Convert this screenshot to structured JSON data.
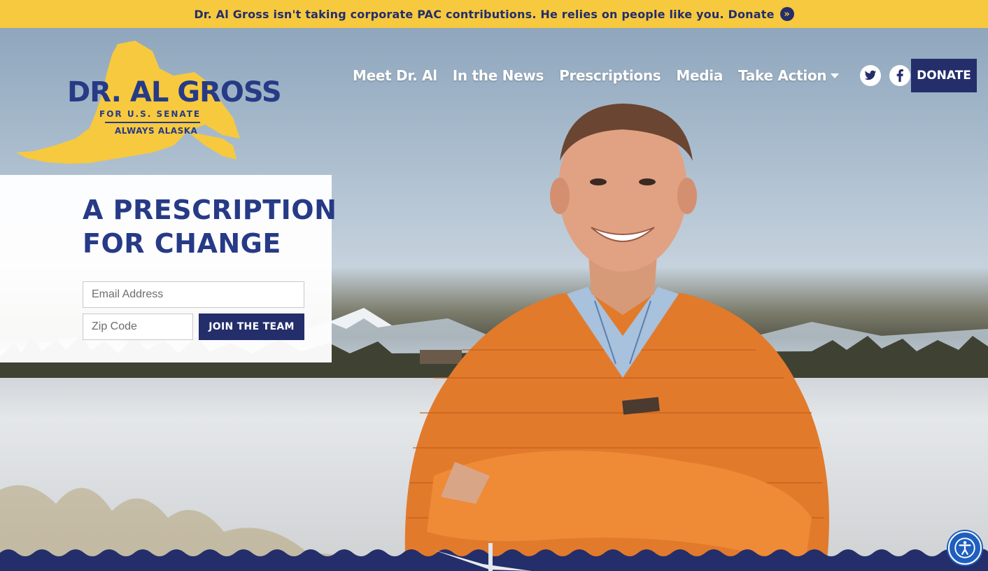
{
  "banner": {
    "text": "Dr. Al Gross isn't taking corporate PAC contributions. He relies on people like you. Donate",
    "arrow_glyph": "»"
  },
  "logo": {
    "name": "DR. AL GROSS",
    "subtitle": "FOR U.S. SENATE",
    "tagline": "ALWAYS ALASKA"
  },
  "nav": {
    "items": [
      {
        "label": "Meet Dr. Al"
      },
      {
        "label": "In the News"
      },
      {
        "label": "Prescriptions"
      },
      {
        "label": "Media"
      },
      {
        "label": "Take Action"
      }
    ],
    "social": [
      "twitter-icon",
      "facebook-icon",
      "instagram-icon"
    ],
    "donate_label": "DONATE"
  },
  "signup": {
    "headline_line1": "A PRESCRIPTION",
    "headline_line2": "FOR CHANGE",
    "email_placeholder": "Email Address",
    "zip_placeholder": "Zip Code",
    "join_label": "JOIN THE TEAM"
  },
  "colors": {
    "banner_bg": "#f7c93e",
    "navy": "#232e6b",
    "logo_yellow": "#f7c93e",
    "accent_orange": "#e8772a"
  },
  "accessibility_icon": "accessibility-icon"
}
